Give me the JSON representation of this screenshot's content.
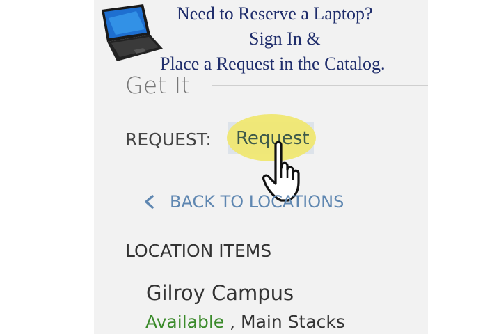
{
  "banner": {
    "line1": "Need to Reserve a Laptop?",
    "line2": "Sign In &",
    "line3": "Place a Request in the Catalog."
  },
  "section": {
    "title": "Get It"
  },
  "request": {
    "label": "REQUEST:",
    "button_label": "Request"
  },
  "nav": {
    "back_label": "BACK TO LOCATIONS"
  },
  "location_items": {
    "heading": "LOCATION ITEMS",
    "campus": "Gilroy Campus",
    "status": "Available",
    "separator": " , ",
    "location": "Main Stacks"
  },
  "colors": {
    "banner_text": "#1f2d6b",
    "highlight": "#f0e76e",
    "available": "#3a8a2a",
    "link": "#5f87b1"
  },
  "icons": [
    "laptop-icon",
    "pointing-hand-icon",
    "chevron-left-icon"
  ]
}
